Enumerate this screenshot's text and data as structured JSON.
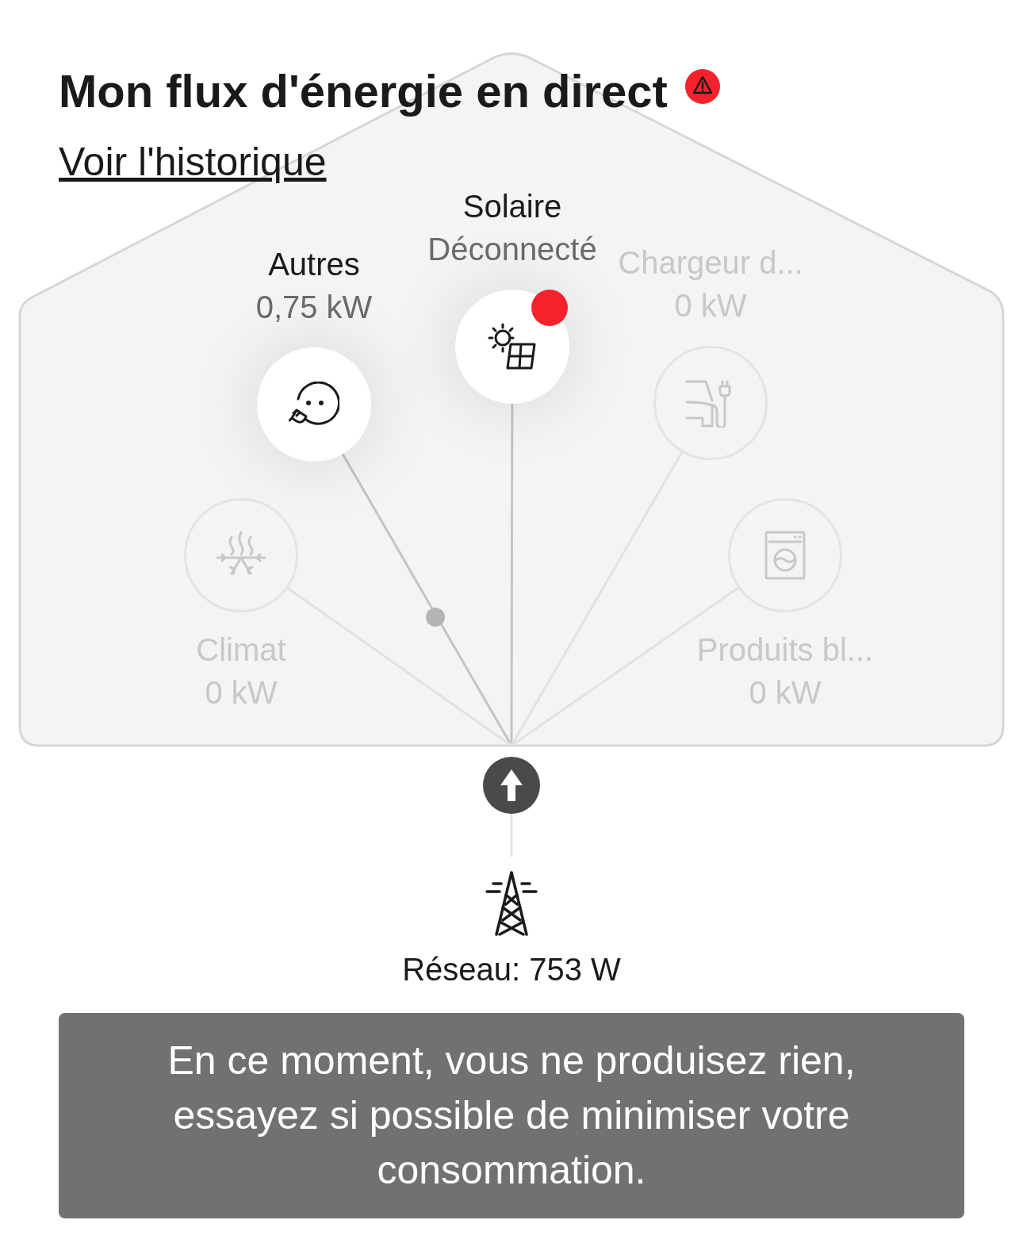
{
  "header": {
    "title": "Mon flux d'énergie en direct",
    "alert": true,
    "history_link": "Voir l'historique"
  },
  "devices": [
    {
      "kind": "plug",
      "name": "Autres",
      "reading": "0,75 kW",
      "active": true,
      "alert": false
    },
    {
      "kind": "solar",
      "name": "Solaire",
      "reading": "Déconnecté",
      "active": true,
      "alert": true
    },
    {
      "kind": "ev-charger",
      "name": "Chargeur d...",
      "reading": "0 kW",
      "active": false,
      "alert": false
    },
    {
      "kind": "climate",
      "name": "Climat",
      "reading": "0 kW",
      "active": false,
      "alert": false
    },
    {
      "kind": "washer",
      "name": "Produits bl...",
      "reading": "0 kW",
      "active": false,
      "alert": false
    }
  ],
  "grid": {
    "flow_up": true,
    "label": "Réseau: 753 W"
  },
  "message": "En ce moment, vous ne produisez rien, essayez si possible de minimiser votre consommation."
}
